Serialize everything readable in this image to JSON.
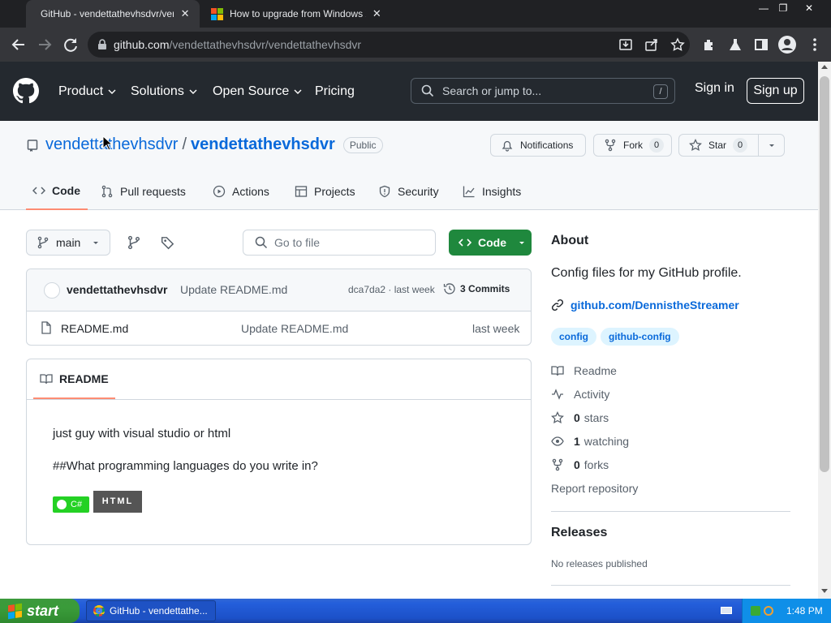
{
  "browser": {
    "tabs": [
      {
        "title": "GitHub - vendettathevhsdvr/vendettathevhsdvr",
        "active": true
      },
      {
        "title": "How to upgrade from Windows XP to Windows 7",
        "active": false
      }
    ],
    "url_host": "github.com",
    "url_path": "/vendettathevhsdvr/vendettathevhsdvr"
  },
  "header": {
    "nav": [
      "Product",
      "Solutions",
      "Open Source",
      "Pricing"
    ],
    "search_placeholder": "Search or jump to...",
    "search_shortcut": "/",
    "sign_in": "Sign in",
    "sign_up": "Sign up"
  },
  "repo": {
    "owner": "vendettathevhsdvr",
    "separator": "/",
    "name": "vendettathevhsdvr",
    "visibility": "Public",
    "notifications": "Notifications",
    "fork_label": "Fork",
    "fork_count": "0",
    "star_label": "Star",
    "star_count": "0",
    "tabs": [
      "Code",
      "Pull requests",
      "Actions",
      "Projects",
      "Security",
      "Insights"
    ]
  },
  "files": {
    "branch": "main",
    "goto_placeholder": "Go to file",
    "code_button": "Code",
    "commit_author": "vendettathevhsdvr",
    "commit_message": "Update README.md",
    "commit_hash_time": "dca7da2 · last week",
    "commits_count": "3 Commits",
    "rows": [
      {
        "name": "README.md",
        "message": "Update README.md",
        "time": "last week"
      }
    ]
  },
  "readme": {
    "tab": "README",
    "line1": "just guy with visual studio or html",
    "line2": "##What programming languages do you write in?",
    "badge_csharp": "C#",
    "badge_html": "HTML"
  },
  "about": {
    "title": "About",
    "description": "Config files for my GitHub profile.",
    "link": "github.com/DennistheStreamer",
    "topics": [
      "config",
      "github-config"
    ],
    "readme": "Readme",
    "activity": "Activity",
    "stars_n": "0",
    "stars_label": "stars",
    "watching_n": "1",
    "watching_label": "watching",
    "forks_n": "0",
    "forks_label": "forks",
    "report": "Report repository",
    "releases_title": "Releases",
    "releases_text": "No releases published"
  },
  "taskbar": {
    "start": "start",
    "task": "GitHub - vendettathe...",
    "clock": "1:48 PM"
  },
  "colors": {
    "accent": "#0969da",
    "green": "#1f883d",
    "header": "#24292f"
  }
}
